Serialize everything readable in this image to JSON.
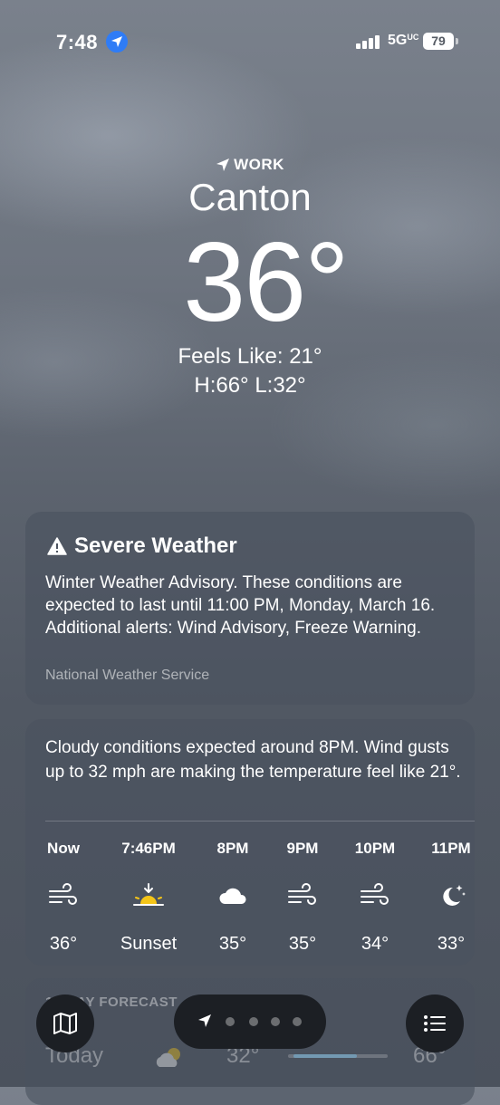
{
  "status_bar": {
    "time": "7:48",
    "network": "5G",
    "network_suffix": "UC",
    "battery": "79"
  },
  "header": {
    "label": "WORK",
    "city": "Canton",
    "temperature": "36°",
    "feels_like": "Feels Like: 21°",
    "high_low": "H:66°  L:32°"
  },
  "alert": {
    "title": "Severe Weather",
    "text": "Winter Weather Advisory. These conditions are expected to last until 11:00 PM, Monday, March 16. Additional alerts: Wind Advisory, Freeze Warning.",
    "source": "National Weather Service"
  },
  "hourly": {
    "summary": "Cloudy conditions expected around 8PM. Wind gusts up to 32 mph are making the temperature feel like 21°.",
    "hours": [
      {
        "label": "Now",
        "icon": "wind-icon",
        "value": "36°"
      },
      {
        "label": "7:46PM",
        "icon": "sunset-icon",
        "value": "Sunset"
      },
      {
        "label": "8PM",
        "icon": "cloud-icon",
        "value": "35°"
      },
      {
        "label": "9PM",
        "icon": "wind-icon",
        "value": "35°"
      },
      {
        "label": "10PM",
        "icon": "wind-icon",
        "value": "34°"
      },
      {
        "label": "11PM",
        "icon": "moon-stars-icon",
        "value": "33°"
      }
    ]
  },
  "ten_day": {
    "title": "10-DAY FORECAST",
    "today": {
      "day": "Today",
      "icon": "partly-cloudy-icon",
      "low": "32°",
      "high": "66°"
    }
  },
  "controls": {
    "map_icon": "map-icon",
    "list_icon": "list-icon",
    "page_count": 4
  }
}
